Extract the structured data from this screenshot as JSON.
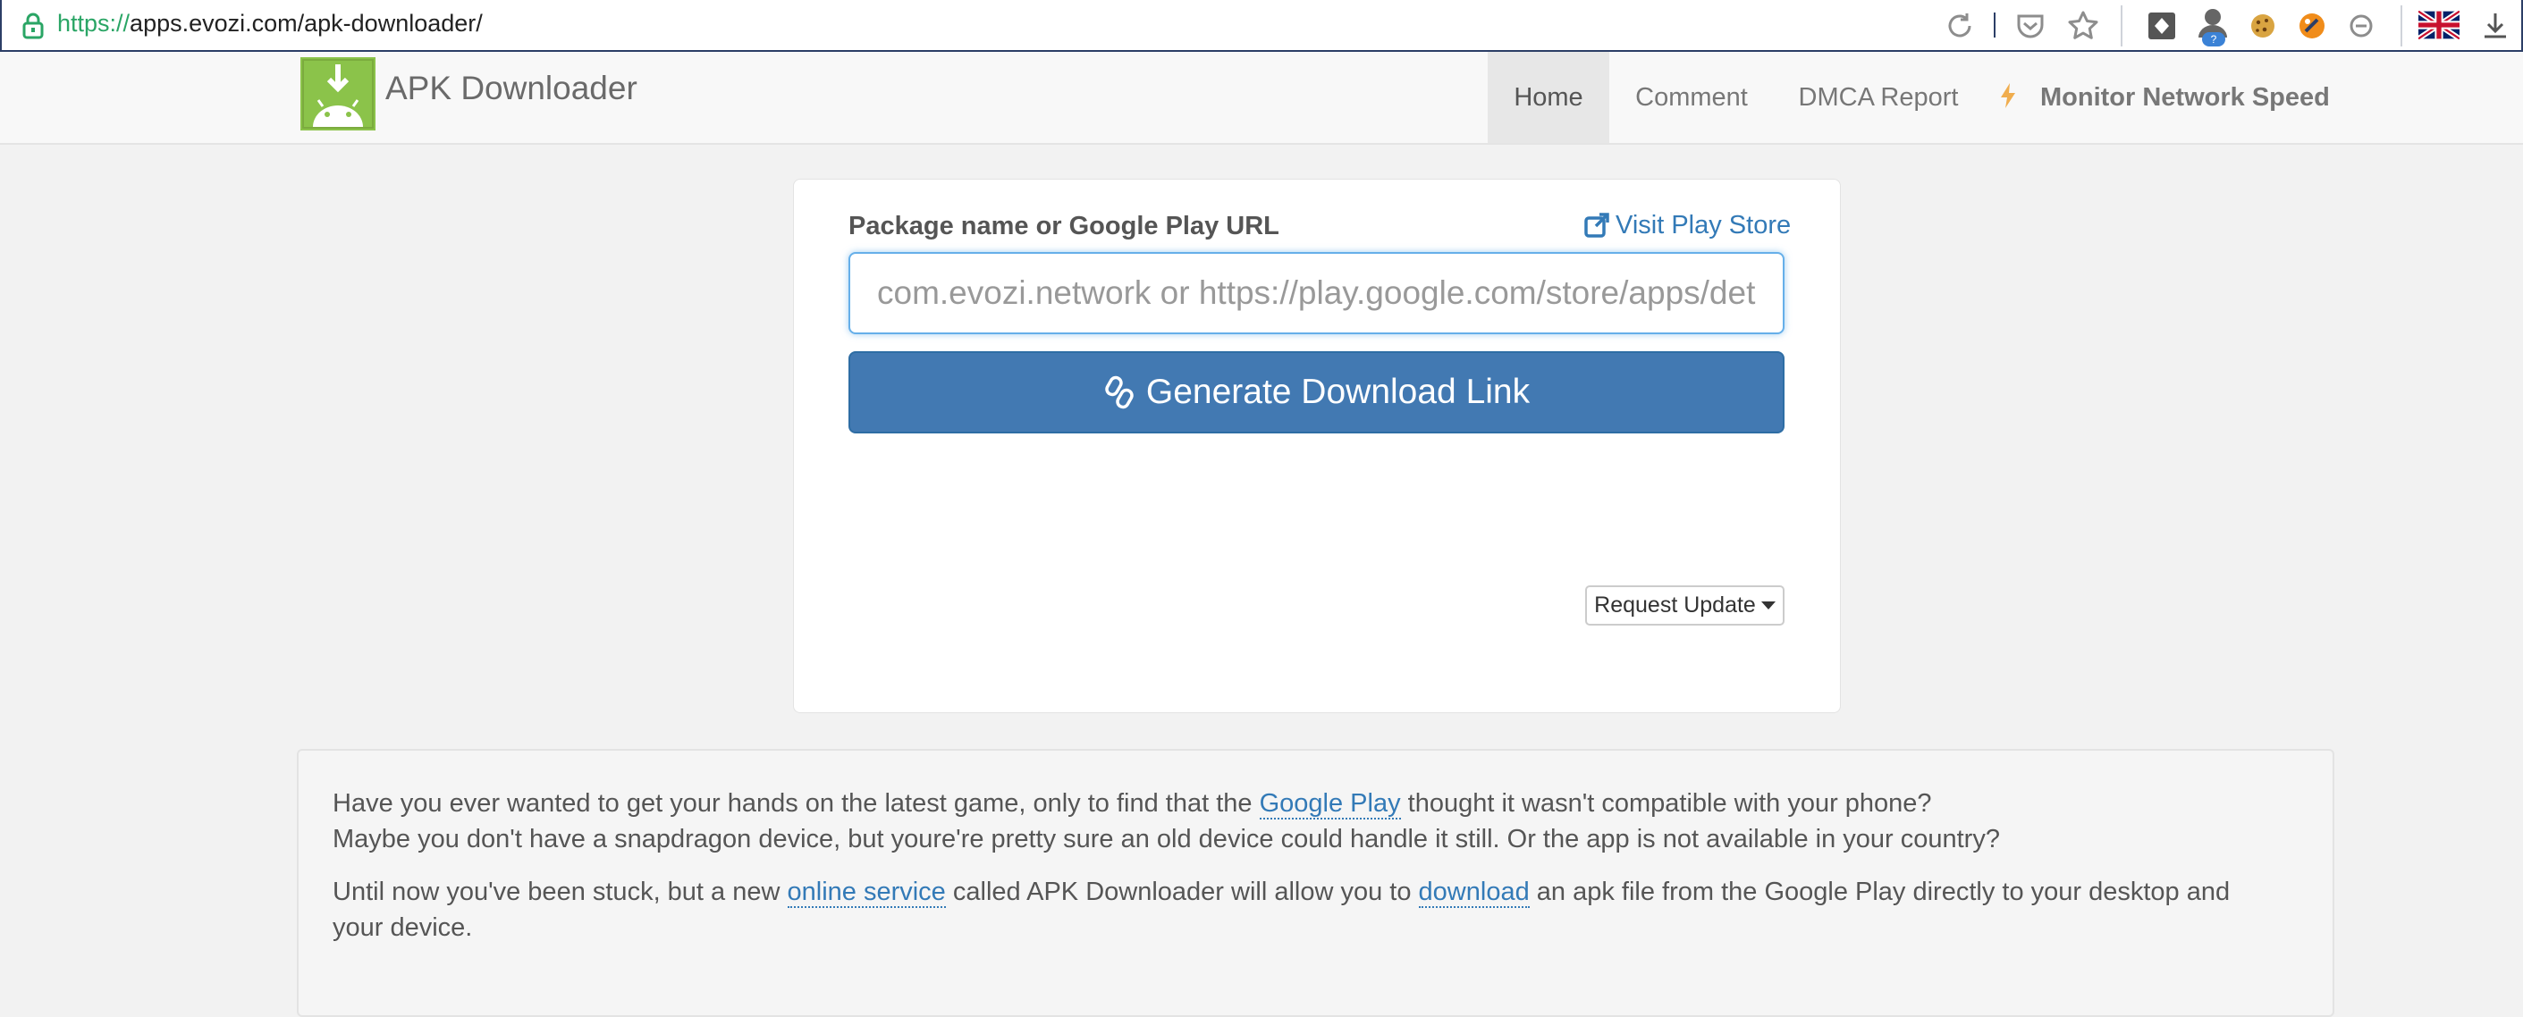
{
  "browser": {
    "url_scheme": "https://",
    "url_rest": "apps.evozi.com/apk-downloader/"
  },
  "header": {
    "brand": "APK Downloader",
    "nav": {
      "home": "Home",
      "comment": "Comment",
      "dmca": "DMCA Report",
      "monitor": "Monitor Network Speed"
    }
  },
  "form": {
    "label": "Package name or Google Play URL",
    "visit_link": "Visit Play Store",
    "input_value": "",
    "input_placeholder": "com.evozi.network or https://play.google.com/store/apps/details?id=com.evozi.network",
    "generate_button": "Generate Download Link",
    "request_update": "Request Update"
  },
  "info": {
    "p1_a": "Have you ever wanted to get your hands on the latest game, only to find that the ",
    "p1_link": "Google Play",
    "p1_b": " thought it wasn't compatible with your phone?",
    "p1_c": "Maybe you don't have a snapdragon device, but youre're pretty sure an old device could handle it still. Or the app is not available in your country?",
    "p2_a": "Until now you've been stuck, but a new ",
    "p2_link1": "online service",
    "p2_b": " called APK Downloader will allow you to ",
    "p2_link2": "download",
    "p2_c": " an apk file from the Google Play directly to your desktop and your device."
  },
  "colors": {
    "accent": "#337ab7",
    "button": "#4279b2",
    "logo_green": "#8bc34a",
    "bolt": "#f0ad4e"
  },
  "icons": [
    "lock-icon",
    "reload-icon",
    "pocket-icon",
    "star-icon",
    "extension-icon",
    "avatar-icon",
    "cookie-icon",
    "extension-orange-icon",
    "minus-circle-icon",
    "uk-flag-icon",
    "download-icon",
    "android-logo-icon",
    "bolt-icon",
    "external-link-icon",
    "link-icon",
    "caret-down-icon"
  ]
}
